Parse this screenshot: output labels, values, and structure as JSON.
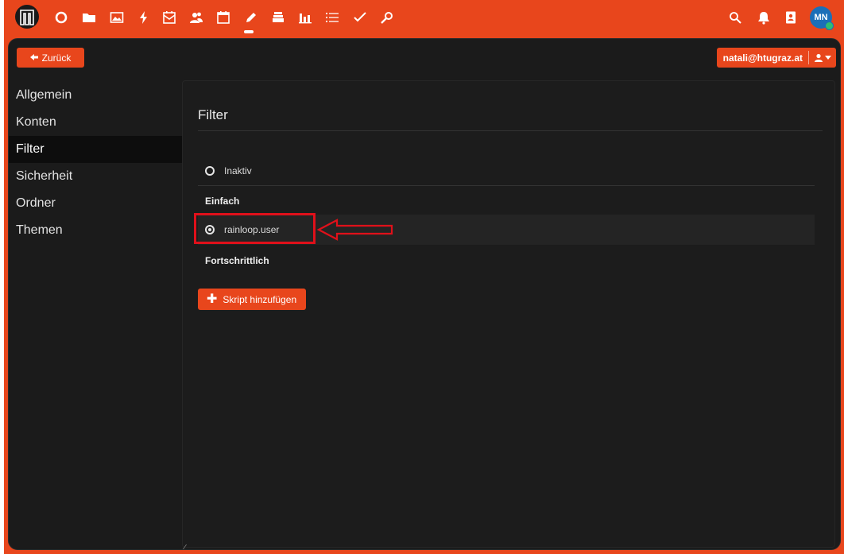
{
  "colors": {
    "accent": "#e8461c",
    "panel": "#1b1b1b",
    "highlight": "#e0101a"
  },
  "topbar": {
    "icons": [
      "circle-icon",
      "folder-icon",
      "image-icon",
      "lightning-icon",
      "mail-calendar-icon",
      "users-icon",
      "calendar-icon",
      "pencil-icon",
      "stack-icon",
      "bar-chart-icon",
      "list-icon",
      "checkmark-icon",
      "key-icon",
      "search-icon",
      "bell-icon",
      "contacts-icon"
    ],
    "avatar_initials": "MN"
  },
  "toolbar": {
    "back_label": "Zurück",
    "account_email": "natali@htugraz.at"
  },
  "sidebar": {
    "items": [
      {
        "label": "Allgemein"
      },
      {
        "label": "Konten"
      },
      {
        "label": "Filter"
      },
      {
        "label": "Sicherheit"
      },
      {
        "label": "Ordner"
      },
      {
        "label": "Themen"
      }
    ],
    "active": "Filter"
  },
  "main": {
    "title": "Filter",
    "inactive_label": "Inaktiv",
    "simple_heading": "Einfach",
    "script_name": "rainloop.user",
    "advanced_heading": "Fortschrittlich",
    "add_script_label": "Skript hinzufügen"
  }
}
